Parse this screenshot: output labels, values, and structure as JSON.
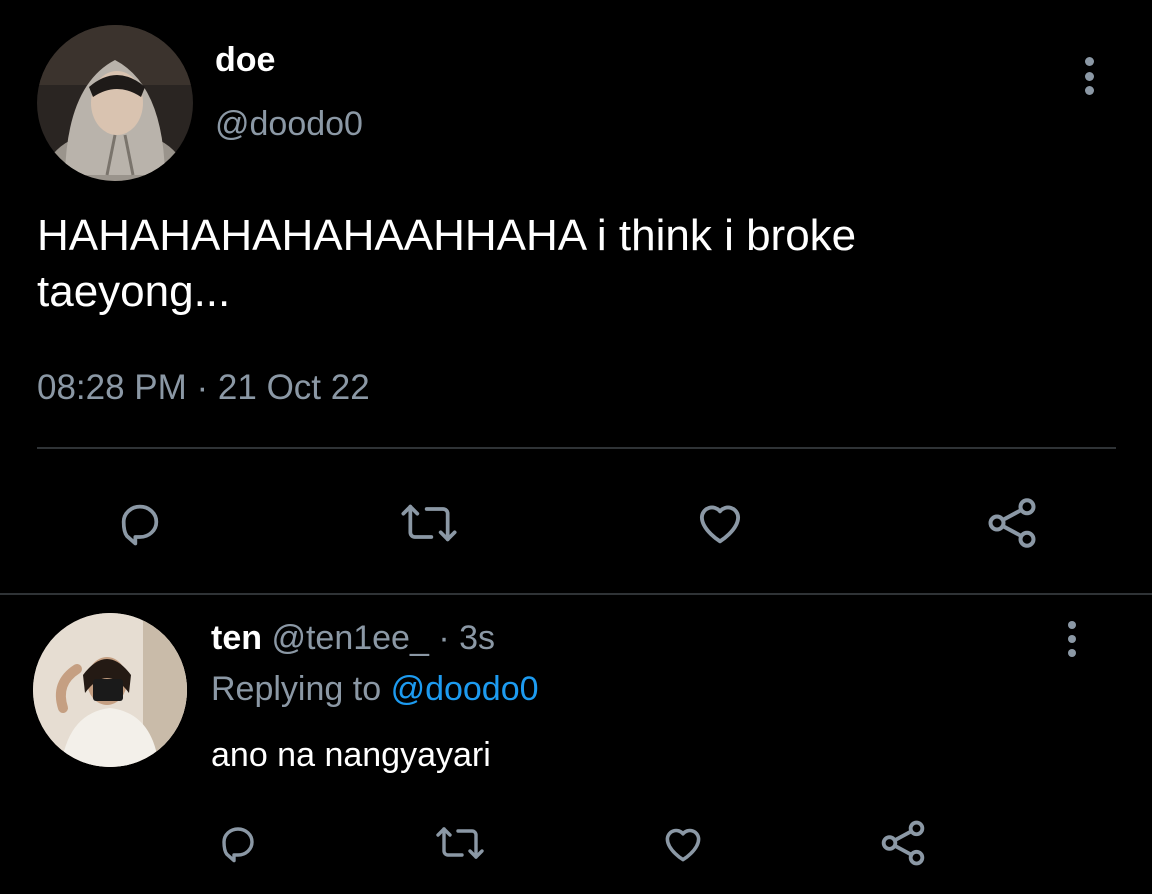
{
  "main_tweet": {
    "display_name": "doe",
    "handle": "@doodo0",
    "text_line1": "HAHAHAHAHAHAAHHAHA i think i broke",
    "text_line2": "taeyong...",
    "timestamp": "08:28 PM · 21 Oct 22",
    "actions": [
      "reply-icon",
      "retweet-icon",
      "like-icon",
      "share-icon"
    ]
  },
  "reply": {
    "display_name": "ten",
    "handle": "@ten1ee_",
    "time": "· 3s",
    "replying_prefix": "Replying to",
    "replying_handle": "@doodo0",
    "text": "ano na nangyayari",
    "actions": [
      "reply-icon",
      "retweet-icon",
      "like-icon",
      "share-icon"
    ]
  },
  "colors": {
    "background": "#000000",
    "text": "#ffffff",
    "secondary": "#8b98a5",
    "link": "#1d9bf0",
    "divider": "#2f3336"
  }
}
